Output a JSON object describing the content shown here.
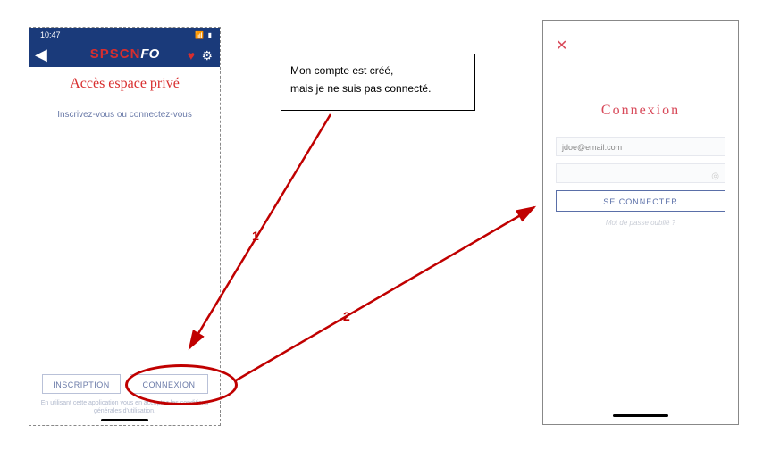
{
  "callout": {
    "line1": "Mon compte est créé,",
    "line2": "mais je ne suis pas connecté."
  },
  "labels": {
    "one": "1",
    "two": "2"
  },
  "phone1": {
    "time": "10:47",
    "logo_red": "SPSCN",
    "logo_white": "FO",
    "title": "Accès espace privé",
    "subtitle": "Inscrivez-vous ou connectez-vous",
    "btn_inscription": "INSCRIPTION",
    "btn_connexion": "CONNEXION",
    "disclaimer": "En utilisant cette application vous en acceptez les conditions générales d'utilisation."
  },
  "phone2": {
    "title": "Connexion",
    "email_value": "jdoe@email.com",
    "password_value": "",
    "btn_login": "SE CONNECTER",
    "forgot": "Mot de passe oublié ?"
  }
}
